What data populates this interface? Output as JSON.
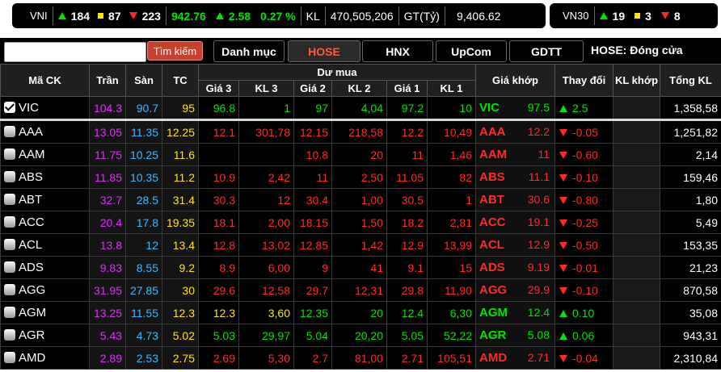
{
  "colors": {
    "up": "#00e400",
    "down": "#ff2a2a",
    "ref": "#ffe600",
    "ceil": "#e22cff",
    "floor": "#41b8ff"
  },
  "index_bar": {
    "name": "VNI",
    "up_count": "184",
    "unchanged_count": "87",
    "down_count": "223",
    "value": "942.76",
    "change": "2.58",
    "change_pct": "0.27 %",
    "vol_label": "KL",
    "volume": "470,505,206",
    "value_label": "GT(Tỷ)",
    "trade_value": "9,406.62"
  },
  "vn30_bar": {
    "name": "VN30",
    "up_count": "19",
    "unchanged_count": "3",
    "down_count": "8"
  },
  "toolbar": {
    "search_placeholder": "",
    "search_button": "Tìm kiếm",
    "tabs": [
      "Danh mục",
      "HOSE",
      "HNX",
      "UpCom",
      "GDTT"
    ],
    "status": "HOSE:  Đóng cửa"
  },
  "headers": {
    "symbol": "Mã CK",
    "ceiling": "Trần",
    "floor": "Sàn",
    "ref": "TC",
    "bid_group": "Dư mua",
    "bid": [
      "Giá 3",
      "KL 3",
      "Giá 2",
      "KL 2",
      "Giá 1",
      "KL 1"
    ],
    "match_price": "Giá khớp",
    "change": "Thay đổi",
    "match_vol": "KL khớp",
    "total_vol": "Tổng KL"
  },
  "rows": [
    {
      "sym": "VIC",
      "checked": true,
      "ceil": "104.3",
      "floor": "90.7",
      "ref": "95",
      "b3": "96.8",
      "v3": "1",
      "b2": "97",
      "v2": "4,04",
      "b1": "97.2",
      "v1": "10",
      "price": "97.5",
      "chg": "2.5",
      "dir": "up",
      "d3": "up",
      "d2": "up",
      "d1": "up",
      "kl": "",
      "total": "1,358,58"
    },
    {
      "sym": "AAA",
      "checked": false,
      "ceil": "13.05",
      "floor": "11.35",
      "ref": "12.25",
      "b3": "12.1",
      "v3": "301,78",
      "b2": "12.15",
      "v2": "218,58",
      "b1": "12.2",
      "v1": "10,49",
      "price": "12.2",
      "chg": "-0.05",
      "dir": "down",
      "d3": "down",
      "d2": "down",
      "d1": "down",
      "kl": "",
      "total": "1,251,82"
    },
    {
      "sym": "AAM",
      "checked": false,
      "ceil": "11.75",
      "floor": "10.25",
      "ref": "11.6",
      "b3": "",
      "v3": "",
      "b2": "10.8",
      "v2": "20",
      "b1": "11",
      "v1": "1,46",
      "price": "11",
      "chg": "-0.60",
      "dir": "down",
      "d3": "down",
      "d2": "down",
      "d1": "down",
      "kl": "",
      "total": "2,14"
    },
    {
      "sym": "ABS",
      "checked": false,
      "ceil": "11.85",
      "floor": "10.35",
      "ref": "11.2",
      "b3": "10.9",
      "v3": "2,42",
      "b2": "11",
      "v2": "2,50",
      "b1": "11.05",
      "v1": "82",
      "price": "11.1",
      "chg": "-0.10",
      "dir": "down",
      "d3": "down",
      "d2": "down",
      "d1": "down",
      "kl": "",
      "total": "159,46"
    },
    {
      "sym": "ABT",
      "checked": false,
      "ceil": "32.7",
      "floor": "28.5",
      "ref": "31.4",
      "b3": "30.3",
      "v3": "12",
      "b2": "30.4",
      "v2": "1,00",
      "b1": "30.5",
      "v1": "1",
      "price": "30.6",
      "chg": "-0.80",
      "dir": "down",
      "d3": "down",
      "d2": "down",
      "d1": "down",
      "kl": "",
      "total": "1,80"
    },
    {
      "sym": "ACC",
      "checked": false,
      "ceil": "20.4",
      "floor": "17.8",
      "ref": "19.35",
      "b3": "18.1",
      "v3": "2,00",
      "b2": "18.15",
      "v2": "1,50",
      "b1": "18.2",
      "v1": "2,81",
      "price": "19.1",
      "chg": "-0.25",
      "dir": "down",
      "d3": "down",
      "d2": "down",
      "d1": "down",
      "kl": "",
      "total": "5,49"
    },
    {
      "sym": "ACL",
      "checked": false,
      "ceil": "13.8",
      "floor": "12",
      "ref": "13.4",
      "b3": "12.8",
      "v3": "13,02",
      "b2": "12.85",
      "v2": "1,42",
      "b1": "12.9",
      "v1": "13,99",
      "price": "12.9",
      "chg": "-0.50",
      "dir": "down",
      "d3": "down",
      "d2": "down",
      "d1": "down",
      "kl": "",
      "total": "153,35"
    },
    {
      "sym": "ADS",
      "checked": false,
      "ceil": "9.83",
      "floor": "8.55",
      "ref": "9.2",
      "b3": "8.9",
      "v3": "6,00",
      "b2": "9",
      "v2": "41",
      "b1": "9.1",
      "v1": "15",
      "price": "9.19",
      "chg": "-0.01",
      "dir": "down",
      "d3": "down",
      "d2": "down",
      "d1": "down",
      "kl": "",
      "total": "21,23"
    },
    {
      "sym": "AGG",
      "checked": false,
      "ceil": "31.95",
      "floor": "27.85",
      "ref": "30",
      "b3": "29.6",
      "v3": "12,58",
      "b2": "29.7",
      "v2": "12,31",
      "b1": "29.8",
      "v1": "11,90",
      "price": "29.9",
      "chg": "-0.10",
      "dir": "down",
      "d3": "down",
      "d2": "down",
      "d1": "down",
      "kl": "",
      "total": "870,58"
    },
    {
      "sym": "AGM",
      "checked": false,
      "ceil": "13.25",
      "floor": "11.55",
      "ref": "12.3",
      "b3": "12.3",
      "v3": "3,60",
      "b2": "12.35",
      "v2": "20",
      "b1": "12.4",
      "v1": "6,30",
      "price": "12.4",
      "chg": "0.10",
      "dir": "up",
      "d3": "ref",
      "d2": "up",
      "d1": "up",
      "kl": "",
      "total": "35,08"
    },
    {
      "sym": "AGR",
      "checked": false,
      "ceil": "5.43",
      "floor": "4.73",
      "ref": "5.02",
      "b3": "5.03",
      "v3": "29,97",
      "b2": "5.04",
      "v2": "20,20",
      "b1": "5.05",
      "v1": "52,22",
      "price": "5.08",
      "chg": "0.06",
      "dir": "up",
      "d3": "up",
      "d2": "up",
      "d1": "up",
      "kl": "",
      "total": "943,31"
    },
    {
      "sym": "AMD",
      "checked": false,
      "ceil": "2.89",
      "floor": "2.53",
      "ref": "2.75",
      "b3": "2.69",
      "v3": "5,30",
      "b2": "2.7",
      "v2": "81,00",
      "b1": "2.71",
      "v1": "105,51",
      "price": "2.71",
      "chg": "-0.04",
      "dir": "down",
      "d3": "down",
      "d2": "down",
      "d1": "down",
      "kl": "",
      "total": "2,310,84"
    }
  ]
}
